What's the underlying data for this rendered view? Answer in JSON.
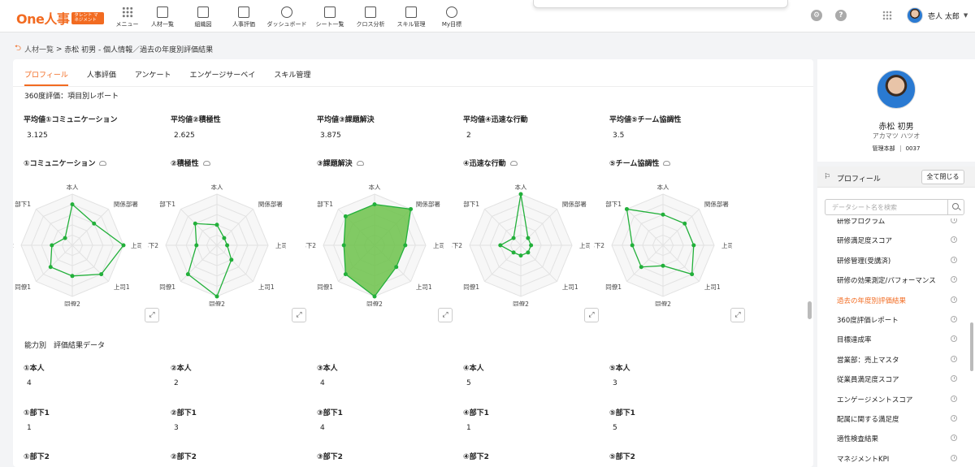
{
  "app": {
    "logo_text": "One人事",
    "logo_badge": "タレント マネジメント"
  },
  "nav": [
    {
      "label": "メニュー",
      "icon": "menu-grid-icon"
    },
    {
      "label": "人材一覧",
      "icon": "people-list-icon"
    },
    {
      "label": "組織図",
      "icon": "org-chart-icon"
    },
    {
      "label": "人事評価",
      "icon": "evaluation-icon"
    },
    {
      "label": "ダッシュボード",
      "icon": "dashboard-icon"
    },
    {
      "label": "シート一覧",
      "icon": "sheet-list-icon"
    },
    {
      "label": "クロス分析",
      "icon": "cross-analysis-icon"
    },
    {
      "label": "スキル管理",
      "icon": "skill-icon"
    },
    {
      "label": "My目標",
      "icon": "target-icon"
    }
  ],
  "user": {
    "name": "壱人 太郎"
  },
  "breadcrumb": {
    "link": "人材一覧",
    "current": "赤松 初男 - 個人情報／過去の年度別評価結果"
  },
  "tabs": [
    "プロフィール",
    "人事評価",
    "アンケート",
    "エンゲージサーベイ",
    "スキル管理"
  ],
  "report_title": "360度評価：項目別レポート",
  "averages": [
    {
      "label": "平均値①コミュニケーション",
      "value": "3.125"
    },
    {
      "label": "平均値②積極性",
      "value": "2.625"
    },
    {
      "label": "平均値③課題解決",
      "value": "3.875"
    },
    {
      "label": "平均値④迅速な行動",
      "value": "2"
    },
    {
      "label": "平均値⑤チーム協調性",
      "value": "3.5"
    }
  ],
  "chart_data": [
    {
      "type": "radar",
      "title": "①コミュニケーション",
      "axes": [
        "本人",
        "関係部署",
        "上司2",
        "上司1",
        "同僚2",
        "同僚1",
        "部下2",
        "部下1"
      ],
      "values": [
        4,
        3,
        5,
        4,
        3,
        3,
        2,
        1
      ],
      "max": 5,
      "filled": false
    },
    {
      "type": "radar",
      "title": "②積極性",
      "axes": [
        "本人",
        "関係部署",
        "上司2",
        "上司1",
        "同僚2",
        "同僚1",
        "部下2",
        "部下1"
      ],
      "values": [
        2,
        1,
        1,
        2,
        5,
        4,
        2,
        3
      ],
      "max": 5,
      "filled": false
    },
    {
      "type": "radar",
      "title": "③課題解決",
      "axes": [
        "本人",
        "関係部署",
        "上司2",
        "上司1",
        "同僚2",
        "同僚1",
        "部下2",
        "部下1"
      ],
      "values": [
        4,
        5,
        3,
        3,
        5,
        4,
        3,
        4
      ],
      "max": 5,
      "filled": true
    },
    {
      "type": "radar",
      "title": "④迅速な行動",
      "axes": [
        "本人",
        "関係部署",
        "上司2",
        "上司1",
        "同僚2",
        "同僚1",
        "部下2",
        "部下1"
      ],
      "values": [
        5,
        1,
        1,
        1,
        1,
        1,
        2,
        1
      ],
      "max": 5,
      "filled": false
    },
    {
      "type": "radar",
      "title": "⑤チーム協調性",
      "axes": [
        "本人",
        "関係部署",
        "上司2",
        "上司1",
        "同僚2",
        "同僚1",
        "部下2",
        "部下1"
      ],
      "values": [
        3,
        3,
        3,
        4,
        2,
        3,
        3,
        5
      ],
      "max": 5,
      "filled": false
    }
  ],
  "ability_title": "能力別　評価結果データ",
  "fields": [
    [
      {
        "label": "①本人",
        "value": "4"
      },
      {
        "label": "②本人",
        "value": "2"
      },
      {
        "label": "③本人",
        "value": "4"
      },
      {
        "label": "④本人",
        "value": "5"
      },
      {
        "label": "⑤本人",
        "value": "3"
      }
    ],
    [
      {
        "label": "①部下1",
        "value": "1"
      },
      {
        "label": "②部下1",
        "value": "3"
      },
      {
        "label": "③部下1",
        "value": "4"
      },
      {
        "label": "④部下1",
        "value": "1"
      },
      {
        "label": "⑤部下1",
        "value": "5"
      }
    ],
    [
      {
        "label": "①部下2",
        "value": ""
      },
      {
        "label": "②部下2",
        "value": ""
      },
      {
        "label": "③部下2",
        "value": ""
      },
      {
        "label": "④部下2",
        "value": ""
      },
      {
        "label": "⑤部下2",
        "value": ""
      }
    ]
  ],
  "profile": {
    "name": "赤松 初男",
    "kana": "アカマツ ハツオ",
    "dept": "管理本部",
    "id": "0037"
  },
  "panel": {
    "title": "プロフィール",
    "close_all": "全て閉じる",
    "search_placeholder": "データシート名を検索"
  },
  "sheets": [
    "研修プログラム",
    "研修満足度スコア",
    "研修管理(受講済)",
    "研修の効果測定/パフォーマンス",
    "過去の年度別評価結果",
    "360度評価レポート",
    "目標達成率",
    "営業部：売上マスタ",
    "従業員満足度スコア",
    "エンゲージメントスコア",
    "配属に関する満足度",
    "適性検査結果",
    "マネジメントKPI"
  ],
  "active_sheet": 4,
  "colors": {
    "accent": "#f26b21",
    "radar_line": "#22b03a",
    "radar_fill": "#6cc24a"
  }
}
